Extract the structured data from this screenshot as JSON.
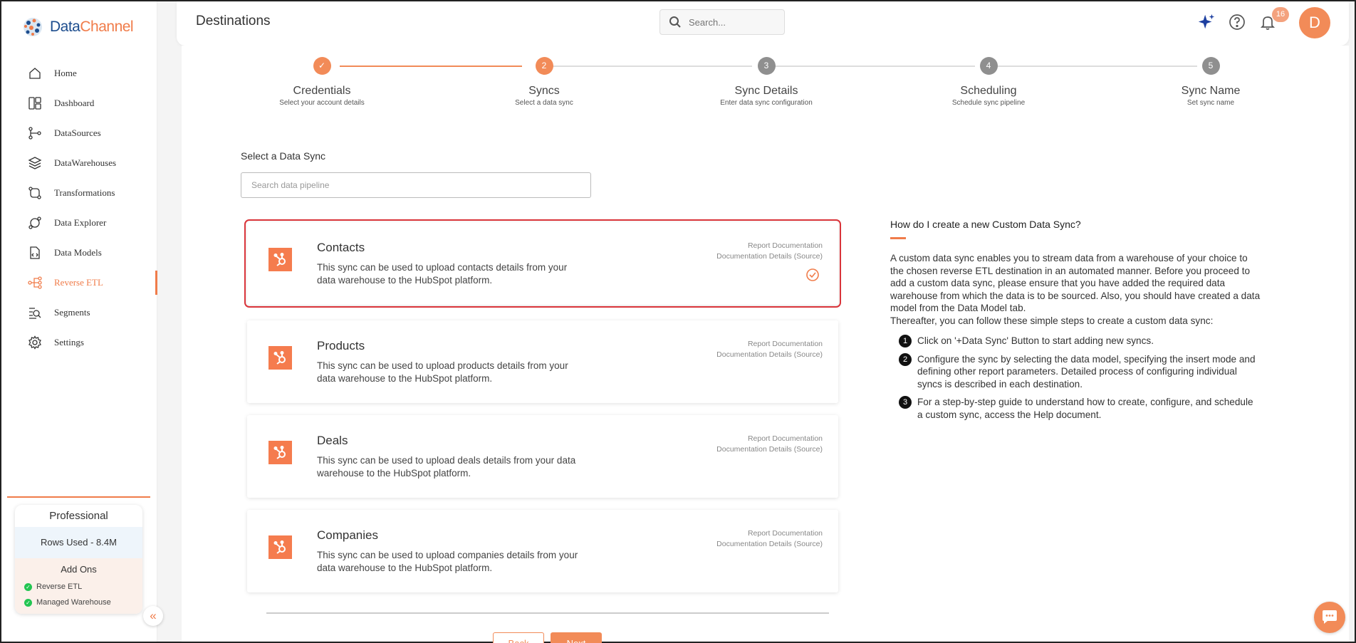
{
  "brand": {
    "name_part1": "Data",
    "name_part2": "Channel"
  },
  "sidebar": {
    "items": [
      {
        "label": "Home",
        "icon": "home-icon"
      },
      {
        "label": "Dashboard",
        "icon": "dashboard-icon"
      },
      {
        "label": "DataSources",
        "icon": "datasources-icon"
      },
      {
        "label": "DataWarehouses",
        "icon": "datawarehouses-icon"
      },
      {
        "label": "Transformations",
        "icon": "transformations-icon"
      },
      {
        "label": "Data Explorer",
        "icon": "data-explorer-icon"
      },
      {
        "label": "Data Models",
        "icon": "data-models-icon"
      },
      {
        "label": "Reverse ETL",
        "icon": "reverse-etl-icon",
        "active": true
      },
      {
        "label": "Segments",
        "icon": "segments-icon"
      },
      {
        "label": "Settings",
        "icon": "settings-icon"
      }
    ],
    "plan": {
      "name": "Professional",
      "rows_used": "Rows Used - 8.4M",
      "addons_title": "Add Ons",
      "addons": [
        "Reverse ETL",
        "Managed Warehouse"
      ]
    },
    "collapse_icon": "double-chevron-left-icon"
  },
  "header": {
    "title": "Destinations",
    "search_placeholder": "Search...",
    "notification_count": "16",
    "avatar_initial": "D"
  },
  "stepper": {
    "steps": [
      {
        "number": "1",
        "title": "Credentials",
        "subtitle": "Select your account details",
        "state": "done"
      },
      {
        "number": "2",
        "title": "Syncs",
        "subtitle": "Select a data sync",
        "state": "current"
      },
      {
        "number": "3",
        "title": "Sync Details",
        "subtitle": "Enter data sync configuration",
        "state": "todo"
      },
      {
        "number": "4",
        "title": "Scheduling",
        "subtitle": "Schedule sync pipeline",
        "state": "todo"
      },
      {
        "number": "5",
        "title": "Sync Name",
        "subtitle": "Set sync name",
        "state": "todo"
      }
    ]
  },
  "sync_section": {
    "label": "Select a Data Sync",
    "search_placeholder": "Search data pipeline",
    "doc_link_1": "Report Documentation",
    "doc_link_2": "Documentation Details (Source)",
    "syncs": [
      {
        "name": "Contacts",
        "description": "This sync can be used to upload contacts details from your data warehouse to the HubSpot platform.",
        "selected": true
      },
      {
        "name": "Products",
        "description": "This sync can be used to upload products details from your data warehouse to the HubSpot platform.",
        "selected": false
      },
      {
        "name": "Deals",
        "description": "This sync can be used to upload deals details from your data warehouse to the HubSpot platform.",
        "selected": false
      },
      {
        "name": "Companies",
        "description": "This sync can be used to upload companies details from your data warehouse to the HubSpot platform.",
        "selected": false
      }
    ],
    "back_label": "Back",
    "next_label": "Next"
  },
  "help": {
    "title": "How do I create a new Custom Data Sync?",
    "body": "A custom data sync enables you to stream data from a warehouse of your choice to the chosen reverse ETL destination in an automated manner. Before you proceed to add a custom data sync, please ensure that you have added the required data warehouse from which the data is to be sourced. Also, you should have created a data model from the Data Model tab.",
    "body2": "Thereafter, you can follow these simple steps to create a custom data sync:",
    "steps": [
      {
        "num": "1",
        "text": "Click on '+Data Sync' Button to start adding new syncs."
      },
      {
        "num": "2",
        "text": "Configure the sync by selecting the data model, specifying the insert mode and defining other report parameters. Detailed process of configuring individual syncs is described in each destination."
      },
      {
        "num": "3",
        "text": "For a step-by-step guide to understand how to create, configure, and schedule a custom sync, access the Help document."
      }
    ]
  },
  "colors": {
    "accent": "#f07c4a",
    "hubspot": "#f57c4e",
    "selected_border": "#d9343a",
    "step_todo": "#8f8f8f",
    "brand_blue": "#1d4d8e"
  }
}
